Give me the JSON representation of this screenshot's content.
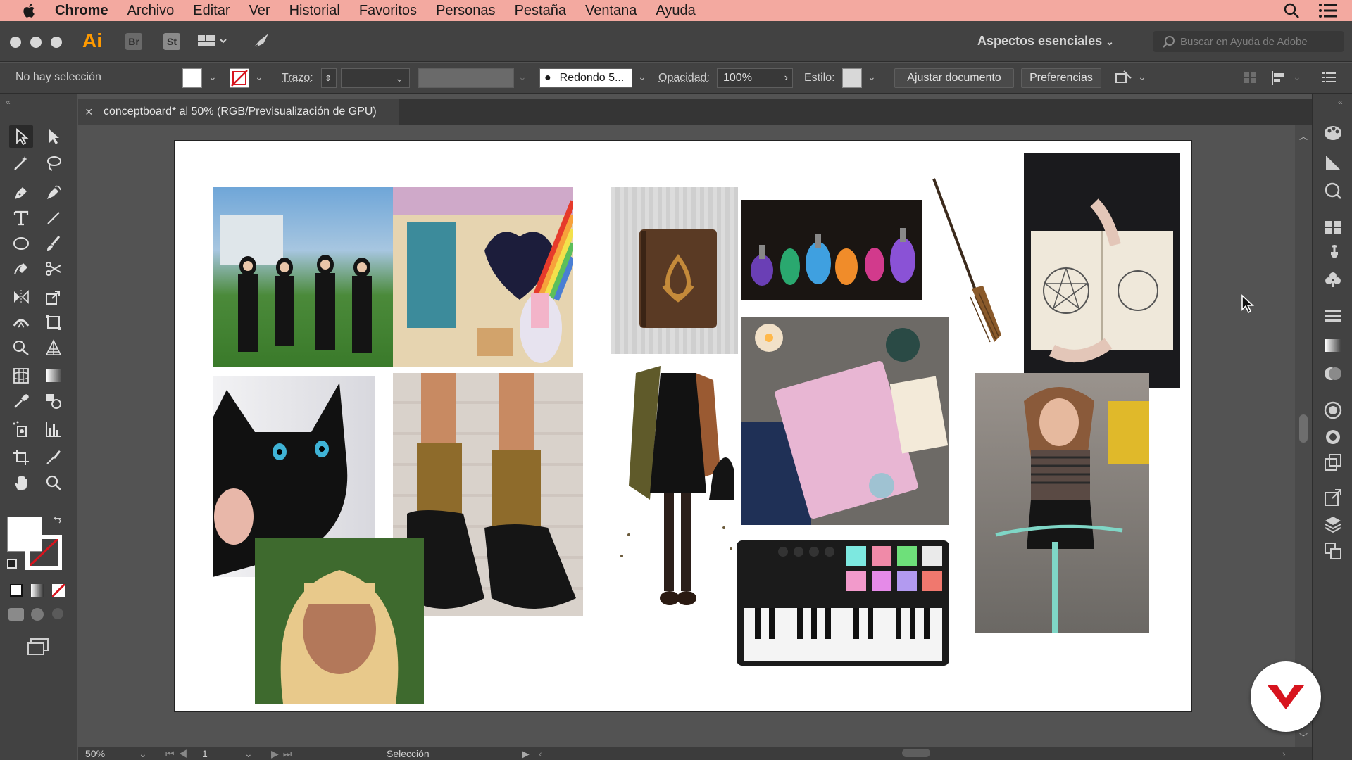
{
  "menubar": {
    "app": "Chrome",
    "items": [
      "Archivo",
      "Editar",
      "Ver",
      "Historial",
      "Favoritos",
      "Personas",
      "Pestaña",
      "Ventana",
      "Ayuda"
    ]
  },
  "appbar": {
    "logo": "Ai",
    "bridge": "Br",
    "stock": "St",
    "workspace": "Aspectos esenciales",
    "search_placeholder": "Buscar en Ayuda de Adobe"
  },
  "control": {
    "selection": "No hay selección",
    "stroke_label": "Trazo:",
    "brush": "Redondo 5...",
    "opacity_label": "Opacidad:",
    "opacity_value": "100%",
    "style_label": "Estilo:",
    "adjust_doc": "Ajustar documento",
    "preferences": "Preferencias"
  },
  "document": {
    "tab_title": "conceptboard* al 50% (RGB/Previsualización de GPU)"
  },
  "status": {
    "zoom": "50%",
    "artboard": "1",
    "mode": "Selección"
  },
  "colors": {
    "menubar": "#f3a9a0",
    "chrome_dark": "#424242",
    "canvas": "#535353",
    "ai_orange": "#ff9a00",
    "brand_red": "#d7141e"
  },
  "collage_icons": [
    "group-photo-icon",
    "illustration-icon",
    "book-icon",
    "potions-icon",
    "broom-icon",
    "spellbook-icon",
    "cat-icon",
    "shoes-icon",
    "outfit-icon",
    "witch-book-icon",
    "portrait-icon",
    "midi-keyboard-icon",
    "cyclist-icon"
  ]
}
